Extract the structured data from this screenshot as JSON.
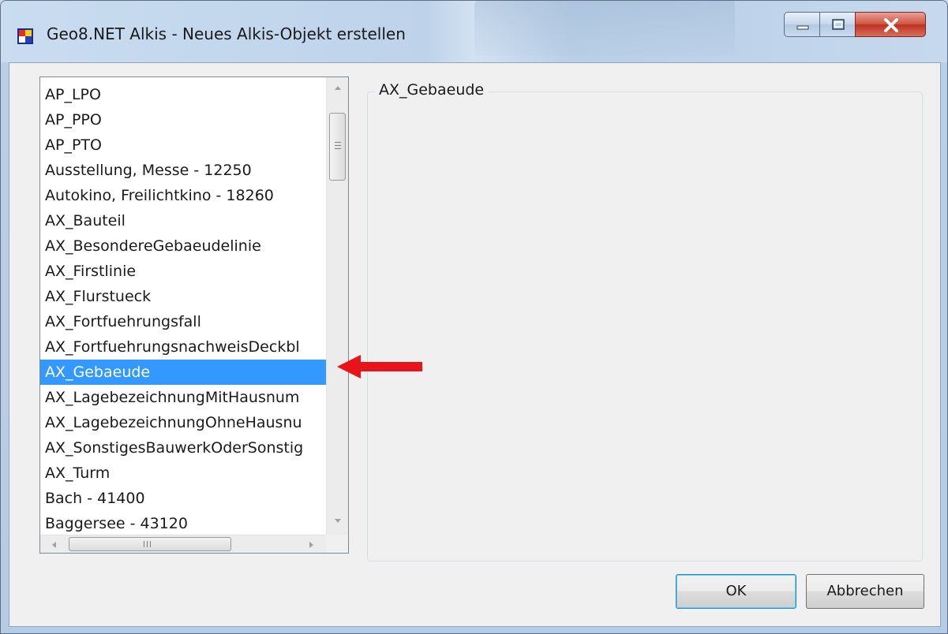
{
  "window": {
    "title": "Geo8.NET Alkis - Neues Alkis-Objekt erstellen",
    "controls": [
      "minimize-icon",
      "maximize-icon",
      "close-icon"
    ]
  },
  "object_list": {
    "items": [
      "AP_LPO",
      "AP_PPO",
      "AP_PTO",
      "Ausstellung, Messe - 12250",
      "Autokino, Freilichtkino - 18260",
      "AX_Bauteil",
      "AX_BesondereGebaeudelinie",
      "AX_Firstlinie",
      "AX_Flurstueck",
      "AX_Fortfuehrungsfall",
      "AX_FortfuehrungsnachweisDeckbl",
      "AX_Gebaeude",
      "AX_LagebezeichnungMitHausnum",
      "AX_LagebezeichnungOhneHausnu",
      "AX_SonstigesBauwerkOderSonstig",
      "AX_Turm",
      "Bach - 41400",
      "Baggersee - 43120"
    ],
    "selected": "AX_Gebaeude",
    "selected_color": "#3399ff"
  },
  "details_group": {
    "title": "AX_Gebaeude"
  },
  "annotation": {
    "arrow_color": "#e8141a"
  },
  "buttons": {
    "ok": "OK",
    "cancel": "Abbrechen"
  }
}
